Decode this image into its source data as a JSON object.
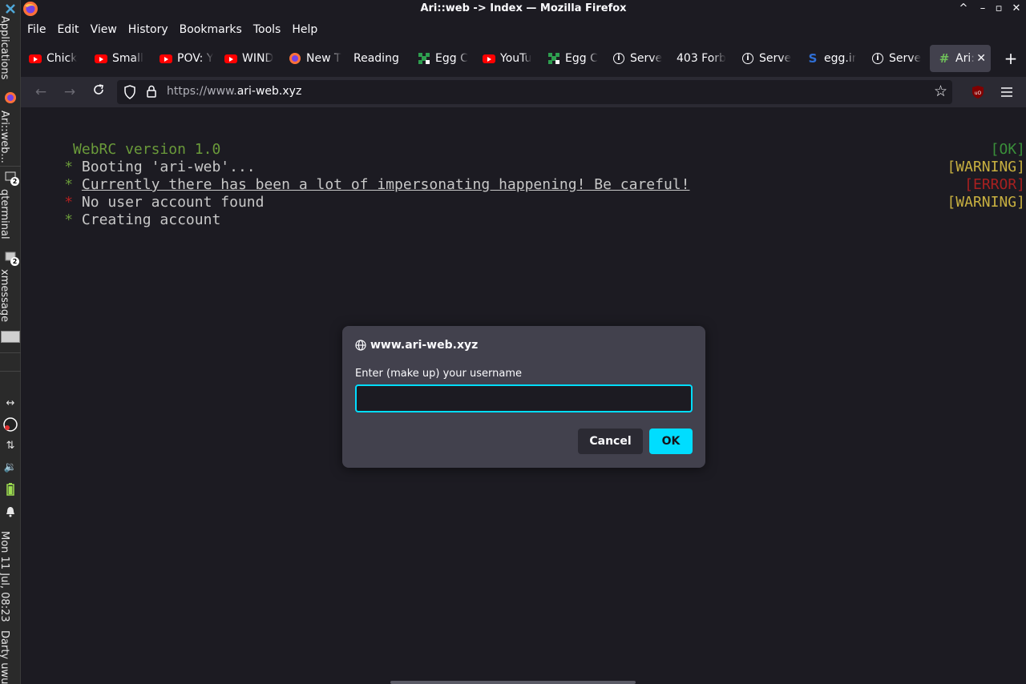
{
  "left_panel": {
    "applications": "Applications",
    "window1": "Ari::web...",
    "window2": "qterminal",
    "window2_badge": "2",
    "window3": "xmessage",
    "window3_badge": "2",
    "clock": "Mon 11 Jul, 08:23",
    "user": "Darty uwu"
  },
  "window": {
    "title": "Ari::web -> Index — Mozilla Firefox"
  },
  "menu": {
    "file": "File",
    "edit": "Edit",
    "view": "View",
    "history": "History",
    "bookmarks": "Bookmarks",
    "tools": "Tools",
    "help": "Help"
  },
  "tabs": [
    {
      "label": "Chick",
      "icon": "youtube-icon"
    },
    {
      "label": "Small",
      "icon": "youtube-icon"
    },
    {
      "label": "POV: Y",
      "icon": "youtube-icon"
    },
    {
      "label": "WIND",
      "icon": "youtube-icon"
    },
    {
      "label": "New T",
      "icon": "firefox-icon"
    },
    {
      "label": "Reading",
      "icon": "none"
    },
    {
      "label": "Egg C",
      "icon": "pixel-icon"
    },
    {
      "label": "YouTu",
      "icon": "youtube-icon"
    },
    {
      "label": "Egg C",
      "icon": "pixel-icon"
    },
    {
      "label": "Serve",
      "icon": "info-icon"
    },
    {
      "label": "403 Forb",
      "icon": "none"
    },
    {
      "label": "Serve",
      "icon": "info-icon"
    },
    {
      "label": "egg.ir",
      "icon": "s-icon"
    },
    {
      "label": "Serve",
      "icon": "info-icon"
    },
    {
      "label": "Ari:",
      "icon": "hash-icon",
      "active": true
    }
  ],
  "urlbar": {
    "prefix": "https://www.",
    "domain": "ari-web.xyz"
  },
  "terminal": {
    "version": "WebRC version 1.0",
    "lines": [
      {
        "bullet": "*",
        "text": "Booting 'ari-web'...",
        "status": "[OK]"
      },
      {
        "bullet": "*",
        "text": "Currently there has been a lot of impersonating happening! Be careful!",
        "status": "[WARNING]"
      },
      {
        "bullet": "*",
        "text": "No user account found",
        "status": "[ERROR]"
      },
      {
        "bullet": "*",
        "text": "Creating account",
        "status": "[WARNING]"
      }
    ]
  },
  "dialog": {
    "host": "www.ari-web.xyz",
    "prompt": "Enter (make up) your username",
    "input_value": "",
    "cancel_label": "Cancel",
    "ok_label": "OK"
  },
  "colors": {
    "accent": "#00ddff",
    "ok": "#3a8f3a",
    "warning": "#c8b040",
    "error": "#a82020",
    "version": "#6a9a3a"
  }
}
